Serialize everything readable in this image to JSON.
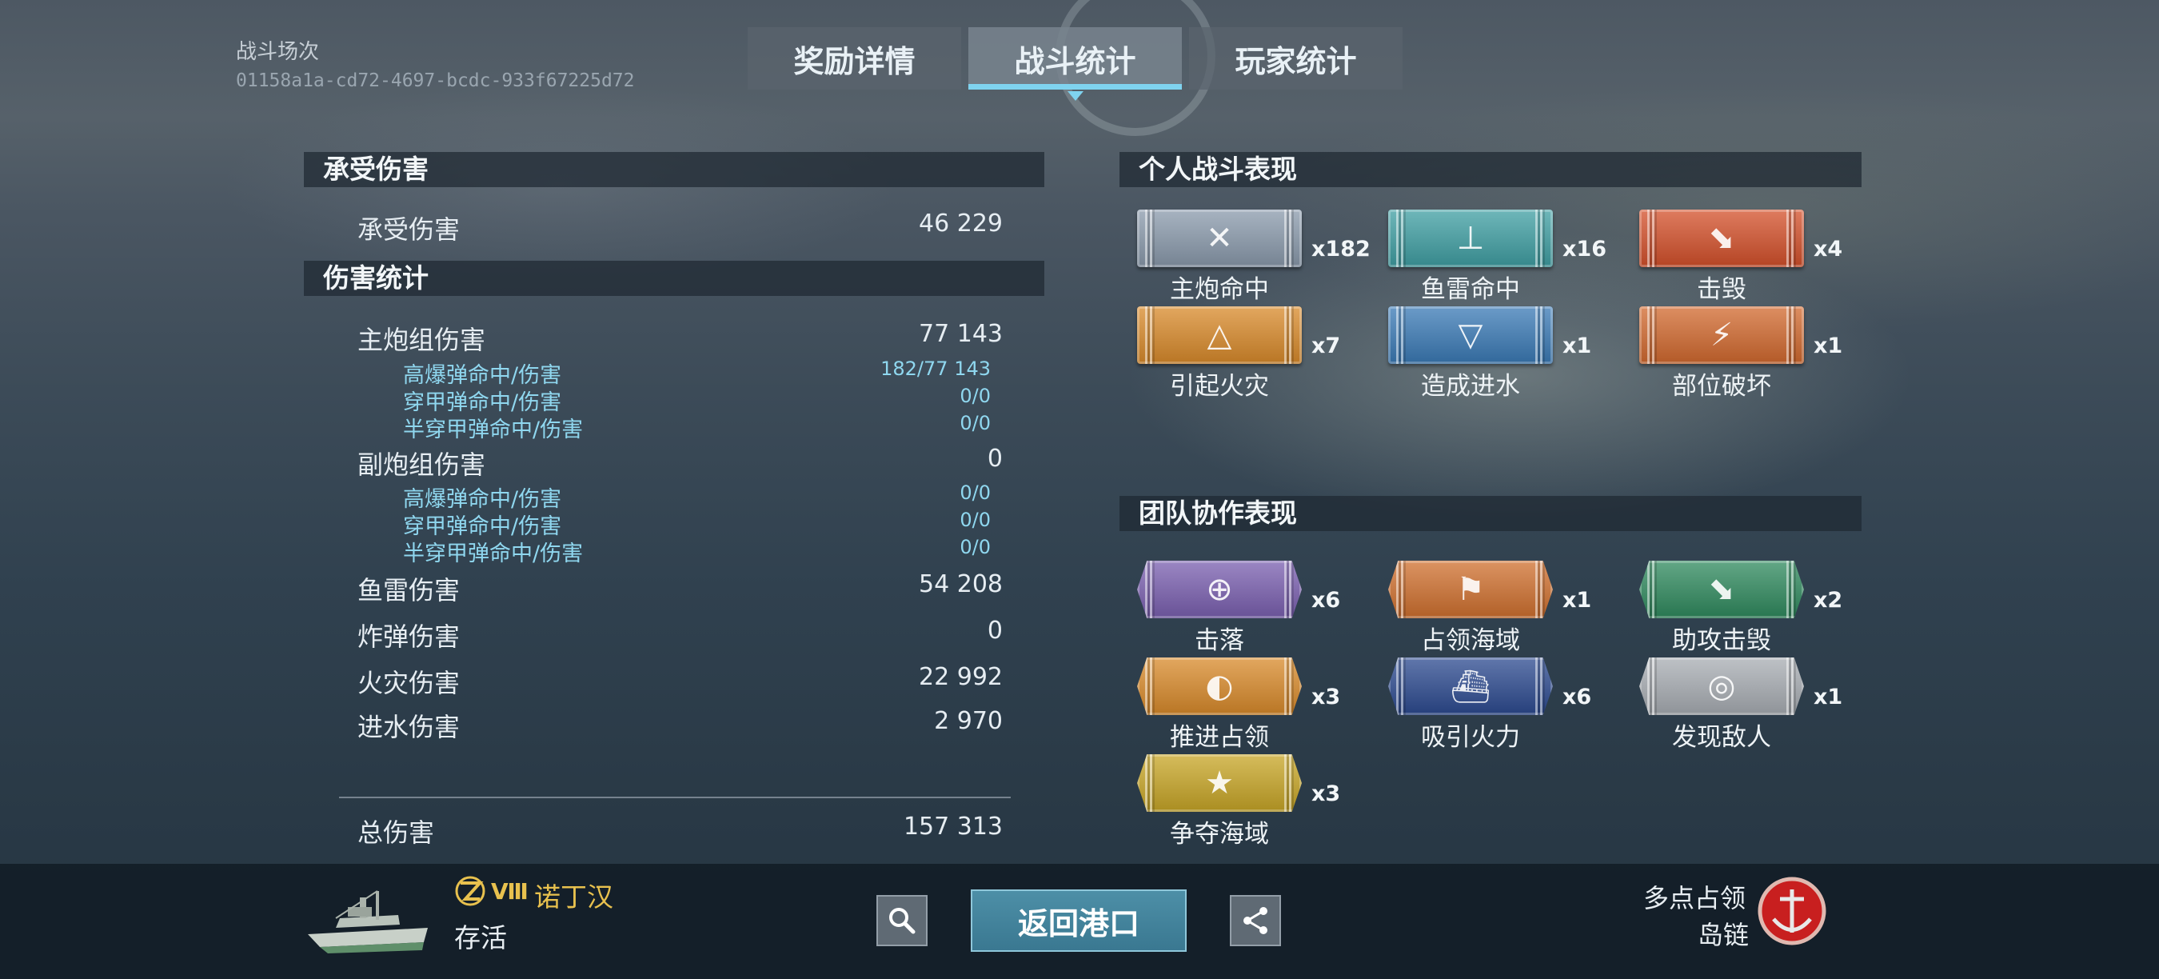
{
  "header": {
    "battle_caption": "战斗场次",
    "battle_id": "01158a1a-cd72-4697-bcdc-933f67225d72",
    "tabs": [
      {
        "label": "奖励详情",
        "active": false
      },
      {
        "label": "战斗统计",
        "active": true
      },
      {
        "label": "玩家统计",
        "active": false
      }
    ]
  },
  "damage_taken": {
    "title": "承受伤害",
    "label": "承受伤害",
    "value": "46 229"
  },
  "damage_stats": {
    "title": "伤害统计",
    "main_battery": {
      "label": "主炮组伤害",
      "value": "77 143"
    },
    "main_sub": [
      {
        "label": "高爆弹命中/伤害",
        "value": "182/77 143"
      },
      {
        "label": "穿甲弹命中/伤害",
        "value": "0/0"
      },
      {
        "label": "半穿甲弹命中/伤害",
        "value": "0/0"
      }
    ],
    "secondary": {
      "label": "副炮组伤害",
      "value": "0"
    },
    "secondary_sub": [
      {
        "label": "高爆弹命中/伤害",
        "value": "0/0"
      },
      {
        "label": "穿甲弹命中/伤害",
        "value": "0/0"
      },
      {
        "label": "半穿甲弹命中/伤害",
        "value": "0/0"
      }
    ],
    "torpedo": {
      "label": "鱼雷伤害",
      "value": "54 208"
    },
    "bomb": {
      "label": "炸弹伤害",
      "value": "0"
    },
    "fire": {
      "label": "火灾伤害",
      "value": "22 992"
    },
    "flooding": {
      "label": "进水伤害",
      "value": "2 970"
    },
    "total": {
      "label": "总伤害",
      "value": "157 313"
    }
  },
  "personal": {
    "title": "个人战斗表现",
    "medals": [
      {
        "label": "主炮命中",
        "count": "x182",
        "color": "#8a9aac",
        "icon": "shells-icon",
        "glyph": "✕"
      },
      {
        "label": "鱼雷命中",
        "count": "x16",
        "color": "#3f9fa3",
        "icon": "torpedo-icon",
        "glyph": "⊥"
      },
      {
        "label": "击毁",
        "count": "x4",
        "color": "#d4502a",
        "icon": "sinking-ship-icon",
        "glyph": "⬊"
      },
      {
        "label": "引起火灾",
        "count": "x7",
        "color": "#d98a2a",
        "icon": "fire-icon",
        "glyph": "△"
      },
      {
        "label": "造成进水",
        "count": "x1",
        "color": "#3a7ab6",
        "icon": "flooding-icon",
        "glyph": "▽"
      },
      {
        "label": "部位破坏",
        "count": "x1",
        "color": "#d2692e",
        "icon": "module-destroyed-icon",
        "glyph": "⚡"
      }
    ]
  },
  "team": {
    "title": "团队协作表现",
    "medals": [
      {
        "label": "击落",
        "count": "x6",
        "color": "#7a5fb0",
        "icon": "plane-shotdown-icon",
        "glyph": "⊕"
      },
      {
        "label": "占领海域",
        "count": "x1",
        "color": "#d0702e",
        "icon": "capture-flag-icon",
        "glyph": "⚑"
      },
      {
        "label": "助攻击毁",
        "count": "x2",
        "color": "#2f8a5e",
        "icon": "assist-kill-icon",
        "glyph": "⬊"
      },
      {
        "label": "推进占领",
        "count": "x3",
        "color": "#d98a2a",
        "icon": "capture-progress-icon",
        "glyph": "◐"
      },
      {
        "label": "吸引火力",
        "count": "x6",
        "color": "#2c4a90",
        "icon": "draw-fire-icon",
        "glyph": "⛴"
      },
      {
        "label": "发现敌人",
        "count": "x1",
        "color": "#a8adb3",
        "icon": "spotting-icon",
        "glyph": "◎"
      },
      {
        "label": "争夺海域",
        "count": "x3",
        "color": "#c8a626",
        "icon": "contest-zone-icon",
        "glyph": "★"
      }
    ]
  },
  "footer": {
    "tier": "Ⅷ",
    "ship_name": "诺丁汉",
    "status": "存活",
    "return_label": "返回港口",
    "mode_line1": "多点占领",
    "mode_line2": "岛链",
    "ship_icon": "ship-icon",
    "mode_icon": "anchor-emblem-icon"
  }
}
